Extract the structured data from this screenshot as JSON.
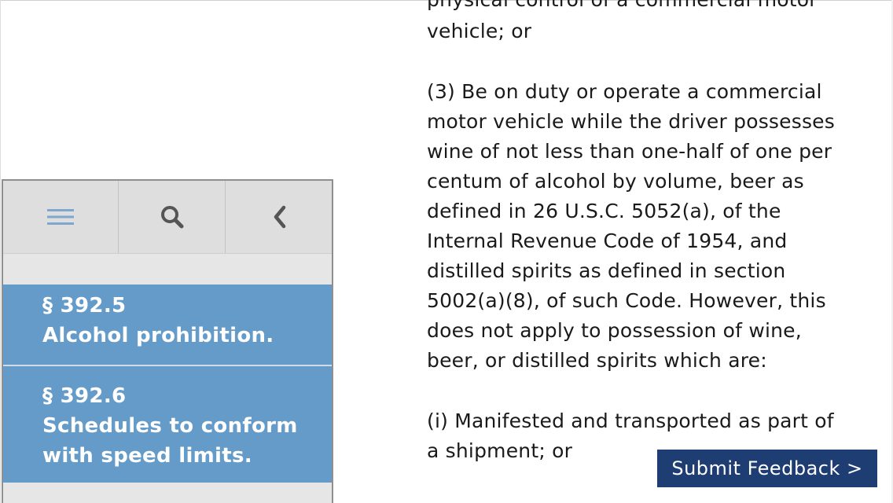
{
  "sidebar": {
    "toolbar": {
      "menu_icon": "hamburger-menu-icon",
      "search_icon": "search-icon",
      "back_icon": "chevron-left-icon"
    },
    "toc": [
      {
        "section": "§ 392.5",
        "title_lines": [
          "Alcohol prohibition."
        ]
      },
      {
        "section": "§ 392.6",
        "title_lines": [
          "Schedules to conform",
          "with speed limits."
        ]
      }
    ],
    "colors": {
      "item_bg": "#659bc9",
      "toolbar_bg": "#dedede"
    }
  },
  "content": {
    "top_fragment": "physical control of a commercial motor",
    "paragraphs": [
      {
        "lines": [
          "vehicle; or"
        ]
      },
      {
        "lines": [
          "(3) Be on duty or operate a commercial",
          "motor vehicle while the driver possesses",
          "wine of not less than one-half of one per",
          "centum of alcohol by volume, beer as",
          "defined in 26 U.S.C. 5052(a), of the",
          "Internal Revenue Code of 1954, and",
          "distilled spirits as defined in section",
          "5002(a)(8), of such Code. However, this",
          "does not apply to possession of wine,",
          "beer, or distilled spirits which are:"
        ]
      },
      {
        "lines": [
          "(i) Manifested and transported as part of",
          "a shipment; or"
        ]
      }
    ]
  },
  "feedback_button": {
    "label": "Submit Feedback >",
    "color": "#1d3d73"
  }
}
